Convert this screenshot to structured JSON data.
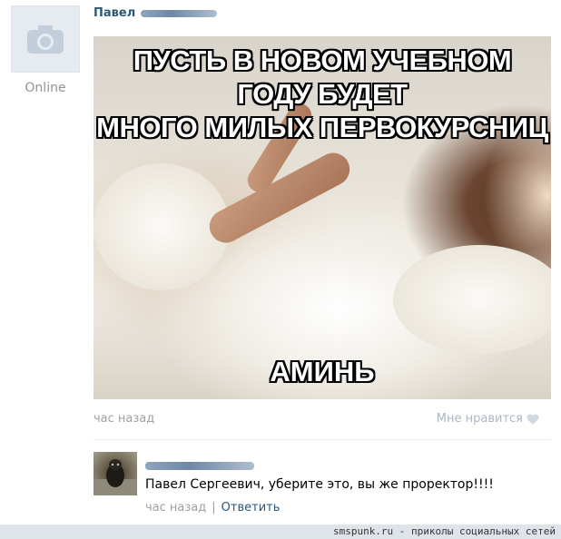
{
  "post": {
    "author_name": "Павел",
    "status": "Online",
    "meme_top_lines": [
      "ПУСТЬ В НОВОМ УЧЕБНОМ ГОДУ БУДЕТ",
      "МНОГО МИЛЫХ ПЕРВОКУРСНИЦ"
    ],
    "meme_bottom": "АМИНЬ",
    "time": "час назад",
    "like_label": "Мне нравится"
  },
  "comment": {
    "text": "Павел Сергеевич, уберите это, вы же проректор!!!!",
    "time": "час назад",
    "separator": "|",
    "reply_label": "Ответить"
  },
  "footer": {
    "watermark": "smspunk.ru - приколы социальных сетей"
  },
  "colors": {
    "link": "#2b587a",
    "muted": "#a0a0a0",
    "like": "#a9b7c6"
  }
}
